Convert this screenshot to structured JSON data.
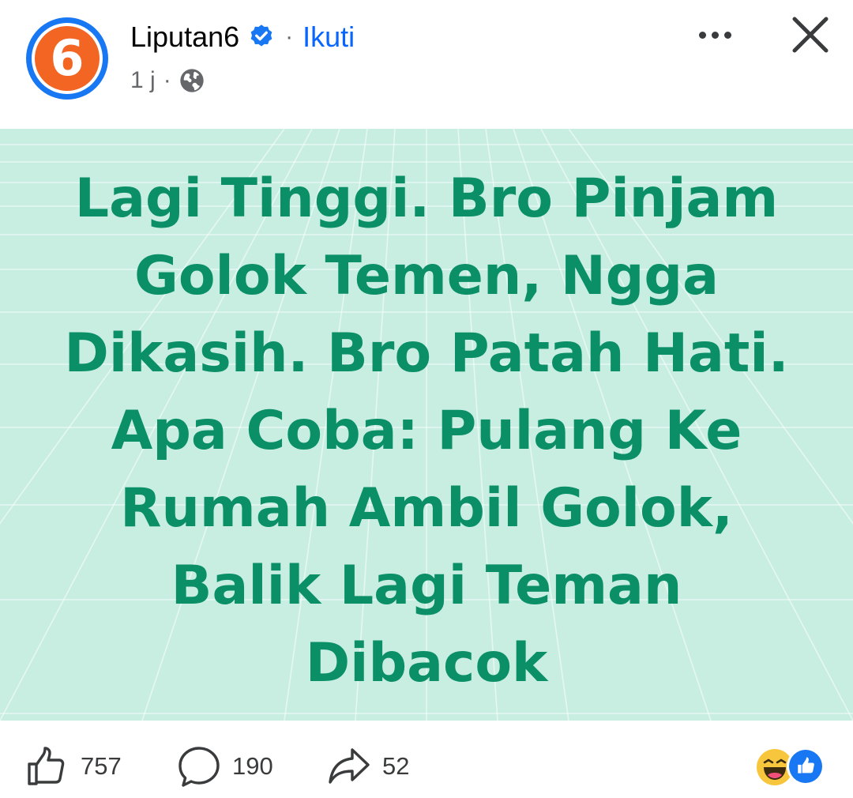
{
  "header": {
    "page_name": "Liputan6",
    "avatar_text": "6",
    "separator": "·",
    "follow_label": "Ikuti",
    "time": "1 j",
    "meta_separator": "·",
    "audience_icon": "globe-icon",
    "verified_icon": "verified-badge-icon",
    "more_icon": "more-options-icon",
    "close_icon": "close-icon"
  },
  "post": {
    "background_color": "#c8eee2",
    "text_color": "#0a8f67",
    "lines": [
      "Lagi Tinggi. Bro Pinjam",
      "Golok Temen, Ngga",
      "Dikasih. Bro Patah Hati.",
      "Apa Coba: Pulang Ke",
      "Rumah Ambil Golok,",
      "Balik Lagi Teman",
      "Dibacok"
    ]
  },
  "footer": {
    "like_count": "757",
    "comment_count": "190",
    "share_count": "52",
    "reactions": [
      "haha-reaction-icon",
      "like-reaction-icon"
    ]
  },
  "colors": {
    "brand_blue": "#1877f2",
    "follow_blue": "#0866ff",
    "avatar_orange": "#f26522",
    "muted_text": "#65676b"
  }
}
